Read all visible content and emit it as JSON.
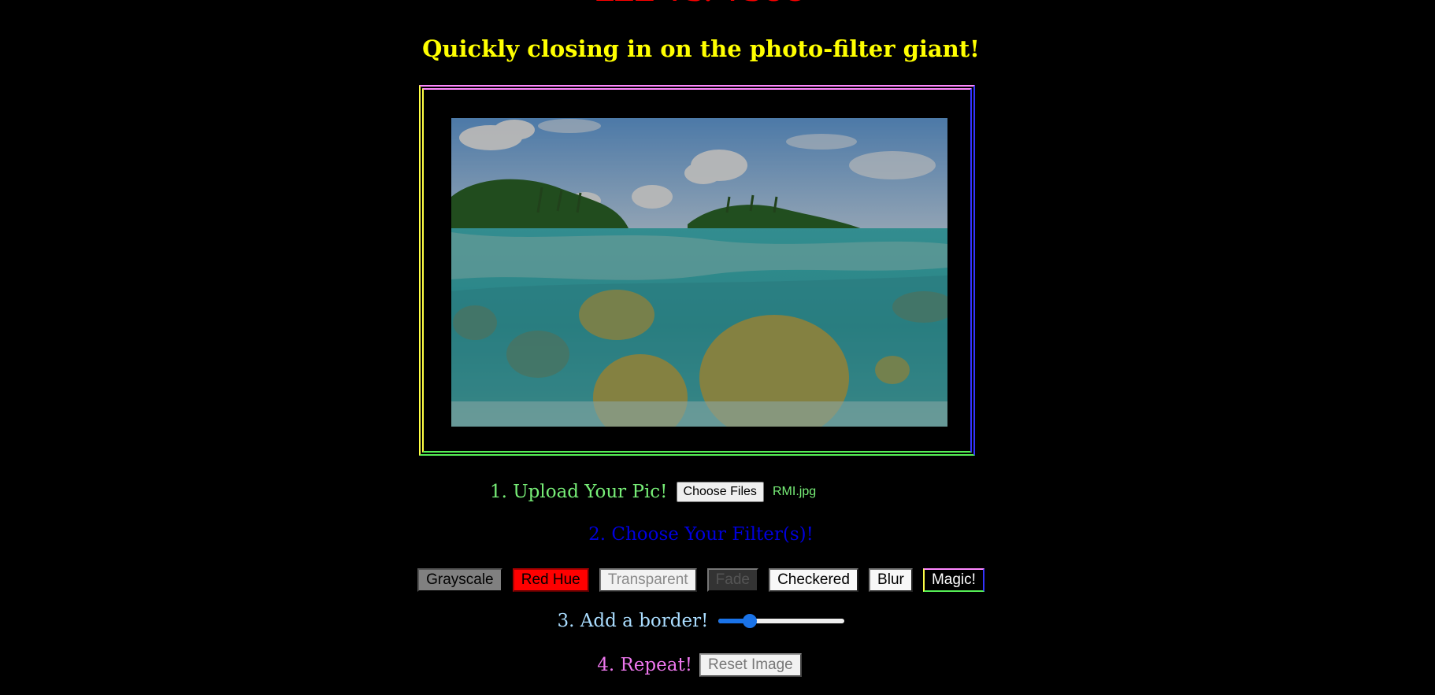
{
  "header": {
    "title": "LEE VS. VSCO",
    "tagline": "Quickly closing in on the photo-filter giant!"
  },
  "canvas": {
    "image_icon": "tropical-reef-photo"
  },
  "step1": {
    "label": "1. Upload Your Pic!",
    "button_label": "Choose Files",
    "file_name": "RMI.jpg"
  },
  "step2": {
    "label": "2. Choose Your Filter(s)!",
    "filters": [
      {
        "label": "Grayscale"
      },
      {
        "label": "Red Hue"
      },
      {
        "label": "Transparent"
      },
      {
        "label": "Fade"
      },
      {
        "label": "Checkered"
      },
      {
        "label": "Blur"
      },
      {
        "label": "Magic!"
      }
    ]
  },
  "step3": {
    "label": "3. Add a border!",
    "slider_value_fraction": 0.25
  },
  "step4": {
    "label": "4. Repeat!",
    "button_label": "Reset Image"
  },
  "colors": {
    "background": "#000000",
    "title": "#ff0000",
    "tagline": "#ffff00",
    "step1": "#77ee77",
    "step2": "#0000dd",
    "step3": "#aaddff",
    "step4": "#ee77ee",
    "slider": "#1a73e8"
  }
}
